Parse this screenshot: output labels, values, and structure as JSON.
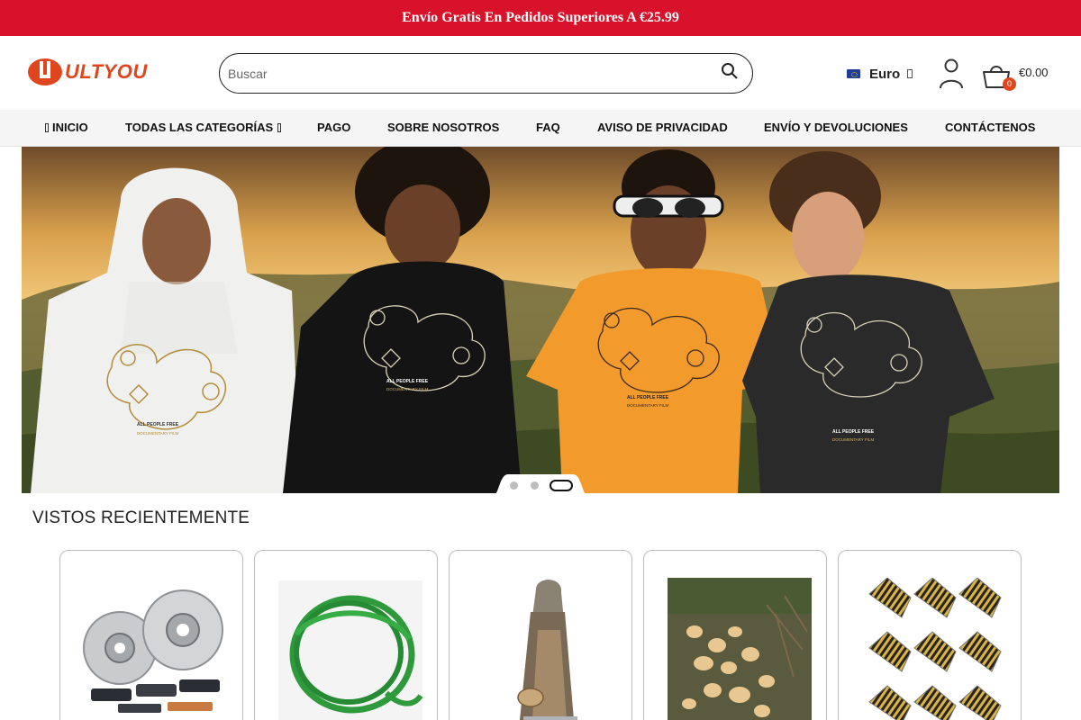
{
  "promo": {
    "text": "Envío Gratis En Pedidos Superiores A €25.99"
  },
  "header": {
    "logo_text": "ULTYOU",
    "search_placeholder": "Buscar",
    "currency_label": "Euro",
    "cart_count": "0",
    "cart_total": "€0.00"
  },
  "nav": {
    "items": [
      {
        "label": "INICIO"
      },
      {
        "label": "TODAS LAS CATEGORÍAS"
      },
      {
        "label": "PAGO"
      },
      {
        "label": "SOBRE NOSOTROS"
      },
      {
        "label": "FAQ"
      },
      {
        "label": "AVISO DE PRIVACIDAD"
      },
      {
        "label": "ENVÍO Y DEVOLUCIONES"
      },
      {
        "label": "CONTÁCTENOS"
      }
    ]
  },
  "hero": {
    "shirt_print_line1": "ALL PEOPLE FREE",
    "shirt_print_line2": "DOCUMENTARY FILM",
    "slide_count": 3,
    "active_slide": 3
  },
  "recently_viewed": {
    "title": "VISTOS RECIENTEMENTE",
    "products": [
      {
        "image": "brake-discs-and-pads"
      },
      {
        "image": "green-round-belt-coil"
      },
      {
        "image": "old-woman-figurine"
      },
      {
        "image": "harvested-potatoes"
      },
      {
        "image": "dart-flights-set"
      }
    ]
  },
  "colors": {
    "promo_red": "#d7122a",
    "brand_orange": "#e0461e",
    "nav_bg": "#f5f5f5"
  }
}
